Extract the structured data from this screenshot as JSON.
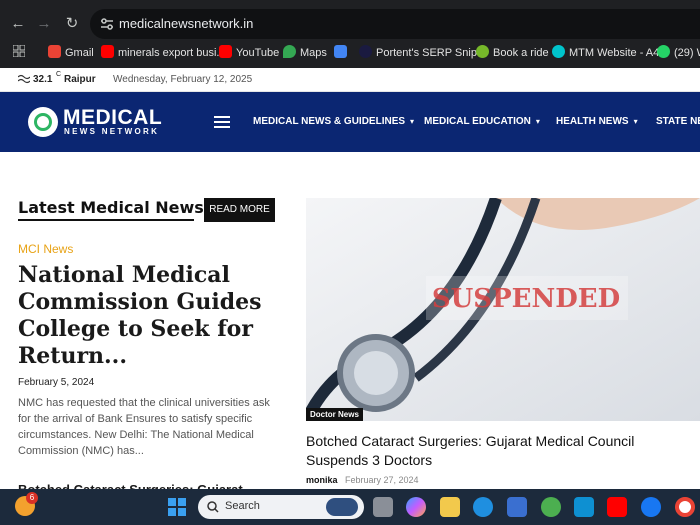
{
  "browser": {
    "url": "medicalnewsnetwork.in",
    "bookmarks": [
      {
        "label": "Gmail",
        "icon": "gmail-icon",
        "color": "#ea4335"
      },
      {
        "label": "minerals export busi...",
        "icon": "youtube-icon",
        "color": "#ff0000"
      },
      {
        "label": "YouTube",
        "icon": "youtube-icon",
        "color": "#ff0000"
      },
      {
        "label": "Maps",
        "icon": "maps-icon",
        "color": "#34a853"
      },
      {
        "label": "",
        "icon": "docs-icon",
        "color": "#4285f4"
      },
      {
        "label": "Portent's SERP Snip...",
        "icon": "portent-icon",
        "color": "#1a1a40"
      },
      {
        "label": "Book a ride",
        "icon": "ride-icon",
        "color": "#76b82a"
      },
      {
        "label": "MTM Website - A4",
        "icon": "canva-icon",
        "color": "#00c4cc"
      },
      {
        "label": "(29) W",
        "icon": "whatsapp-icon",
        "color": "#25d366"
      }
    ]
  },
  "topbar": {
    "temperature": "32.1",
    "unit": "C",
    "city": "Raipur",
    "date": "Wednesday, February 12, 2025"
  },
  "header": {
    "logo_title": "MEDICAL",
    "logo_subtitle": "NEWS NETWORK",
    "nav": [
      {
        "label": "MEDICAL NEWS & GUIDELINES",
        "chevron": "▾"
      },
      {
        "label": "MEDICAL EDUCATION",
        "chevron": "▾"
      },
      {
        "label": "HEALTH NEWS",
        "chevron": "▾"
      },
      {
        "label": "STATE NEW",
        "chevron": ""
      }
    ]
  },
  "latest": {
    "section_title": "Latest Medical News :",
    "read_more": "READ MORE"
  },
  "article1": {
    "category": "MCI News",
    "headline": "National Medical Commission Guides College to Seek for Return...",
    "date": "February 5, 2024",
    "excerpt": "NMC has requested that the clinical universities ask for the arrival of Bank Ensures to satisfy specific circumstances. New Delhi: The National Medical Commission (NMC) has..."
  },
  "article2": {
    "category": "Doctor News",
    "image_text": "SUSPENDED",
    "headline": "Botched Cataract Surgeries:   Gujarat Medical Council Suspends 3 Doctors",
    "author": "monika",
    "date": "February 27, 2024",
    "peek_headline": "Botched Cataract Surgeries:   Gujarat"
  },
  "taskbar": {
    "search_label": "Search",
    "weather_badge": "6"
  },
  "colors": {
    "header_bg": "#0b2672",
    "category_accent": "#e8a317",
    "chrome_bg": "#1f2023",
    "taskbar_bg": "#1c2a3c"
  }
}
